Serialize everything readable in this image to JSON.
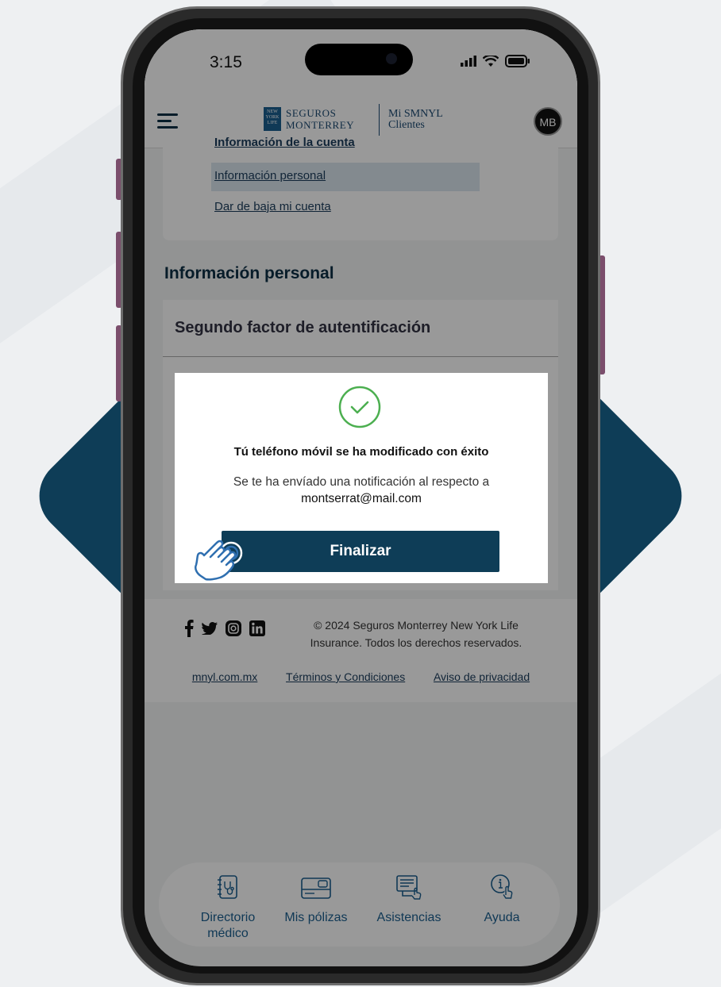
{
  "status_bar": {
    "time": "3:15"
  },
  "header": {
    "brand_line1": "Seguros",
    "brand_line2": "Monterrey",
    "brand_box": [
      "NEW",
      "YORK",
      "LIFE"
    ],
    "portal_line1": "Mi SMNYL",
    "portal_line2": "Clientes",
    "avatar": "MB"
  },
  "account_menu": {
    "items": [
      {
        "label": "Información de la cuenta"
      },
      {
        "label": "Información personal",
        "active": true
      },
      {
        "label": "Dar de baja mi cuenta"
      }
    ]
  },
  "main": {
    "section_title": "Información personal",
    "card_title": "Segundo factor de autentificación"
  },
  "modal": {
    "title": "Tú teléfono móvil se ha modificado con éxito",
    "message": "Se te ha envíado una notificación al respecto a",
    "email": "montserrat@mail.com",
    "button": "Finalizar"
  },
  "footer": {
    "copyright": "© 2024 Seguros Monterrey New York Life Insurance. Todos los derechos reservados.",
    "links": [
      "mnyl.com.mx",
      "Términos y Condiciones",
      "Aviso de privacidad"
    ],
    "social_icons": [
      "facebook-icon",
      "twitter-icon",
      "instagram-icon",
      "linkedin-icon"
    ]
  },
  "bottom_nav": {
    "items": [
      {
        "label": "Directorio médico",
        "icon": "medical-directory-icon"
      },
      {
        "label": "Mis pólizas",
        "icon": "policy-card-icon"
      },
      {
        "label": "Asistencias",
        "icon": "assistance-icon"
      },
      {
        "label": "Ayuda",
        "icon": "help-icon"
      }
    ]
  },
  "colors": {
    "brand_dark": "#0e3d57",
    "brand_blue": "#1c5f8f",
    "success": "#4caf50"
  }
}
